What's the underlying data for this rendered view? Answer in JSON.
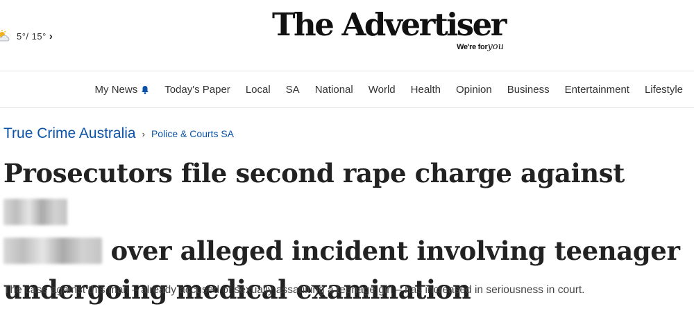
{
  "header": {
    "weather": {
      "icon": "partly-cloudy-icon",
      "text": "5°/ 15°",
      "chevron": "›"
    },
    "masthead": {
      "title": "The Advertiser",
      "tagline_prefix": "We're for",
      "tagline_script": "you"
    }
  },
  "nav": {
    "items": [
      {
        "label": "My News",
        "icon": "bell-icon"
      },
      {
        "label": "Today's Paper"
      },
      {
        "label": "Local"
      },
      {
        "label": "SA"
      },
      {
        "label": "National"
      },
      {
        "label": "World"
      },
      {
        "label": "Health"
      },
      {
        "label": "Opinion"
      },
      {
        "label": "Business"
      },
      {
        "label": "Entertainment"
      },
      {
        "label": "Lifestyle"
      }
    ]
  },
  "breadcrumb": {
    "section": "True Crime Australia",
    "separator": "›",
    "subsection": "Police & Courts SA"
  },
  "article": {
    "headline_part1": "Prosecutors file second rape charge against",
    "headline_part2": "over alleged incident involving teenager undergoing medical examination",
    "standfirst": "The case against this man – already accused of sexually assaulting a teenage girl – has increased in seriousness in court."
  },
  "colors": {
    "link": "#0a53a8",
    "text": "#222222",
    "divider": "#e3e3e3"
  }
}
